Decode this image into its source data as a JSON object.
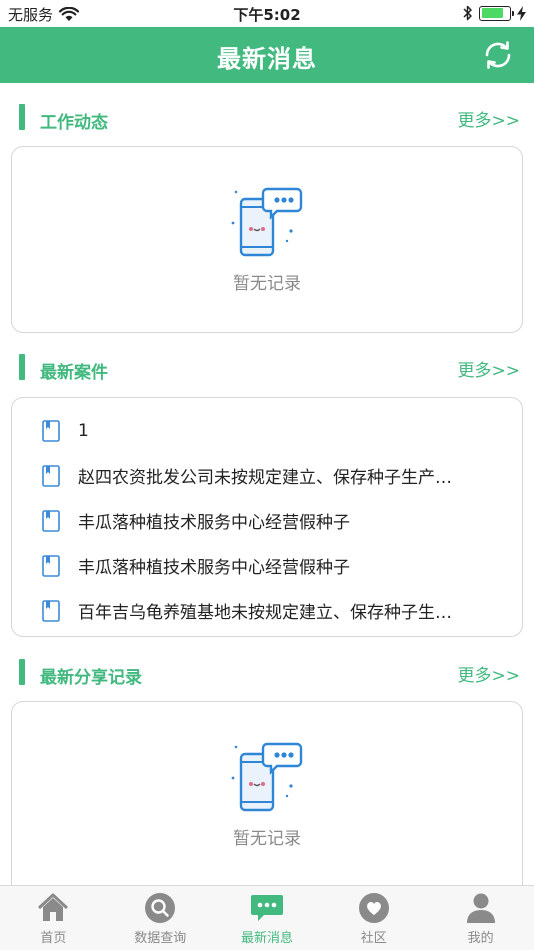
{
  "status_bar": {
    "carrier": "无服务",
    "time": "下午5:02"
  },
  "header": {
    "title": "最新消息"
  },
  "sections": {
    "work": {
      "title": "工作动态",
      "more": "更多>>",
      "empty_text": "暂无记录"
    },
    "cases": {
      "title": "最新案件",
      "more": "更多>>",
      "items": [
        "1",
        "赵四农资批发公司未按规定建立、保存种子生产…",
        "丰瓜落种植技术服务中心经营假种子",
        "丰瓜落种植技术服务中心经营假种子",
        "百年吉乌龟养殖基地未按规定建立、保存种子生…"
      ]
    },
    "share": {
      "title": "最新分享记录",
      "more": "更多>>",
      "empty_text": "暂无记录"
    }
  },
  "tabbar": {
    "tabs": [
      {
        "label": "首页",
        "icon": "home-icon"
      },
      {
        "label": "数据查询",
        "icon": "search-icon"
      },
      {
        "label": "最新消息",
        "icon": "message-icon"
      },
      {
        "label": "社区",
        "icon": "community-icon"
      },
      {
        "label": "我的",
        "icon": "person-icon"
      }
    ],
    "active_index": 2
  },
  "colors": {
    "accent": "#41b97f",
    "inactive": "#8a8a8a"
  }
}
